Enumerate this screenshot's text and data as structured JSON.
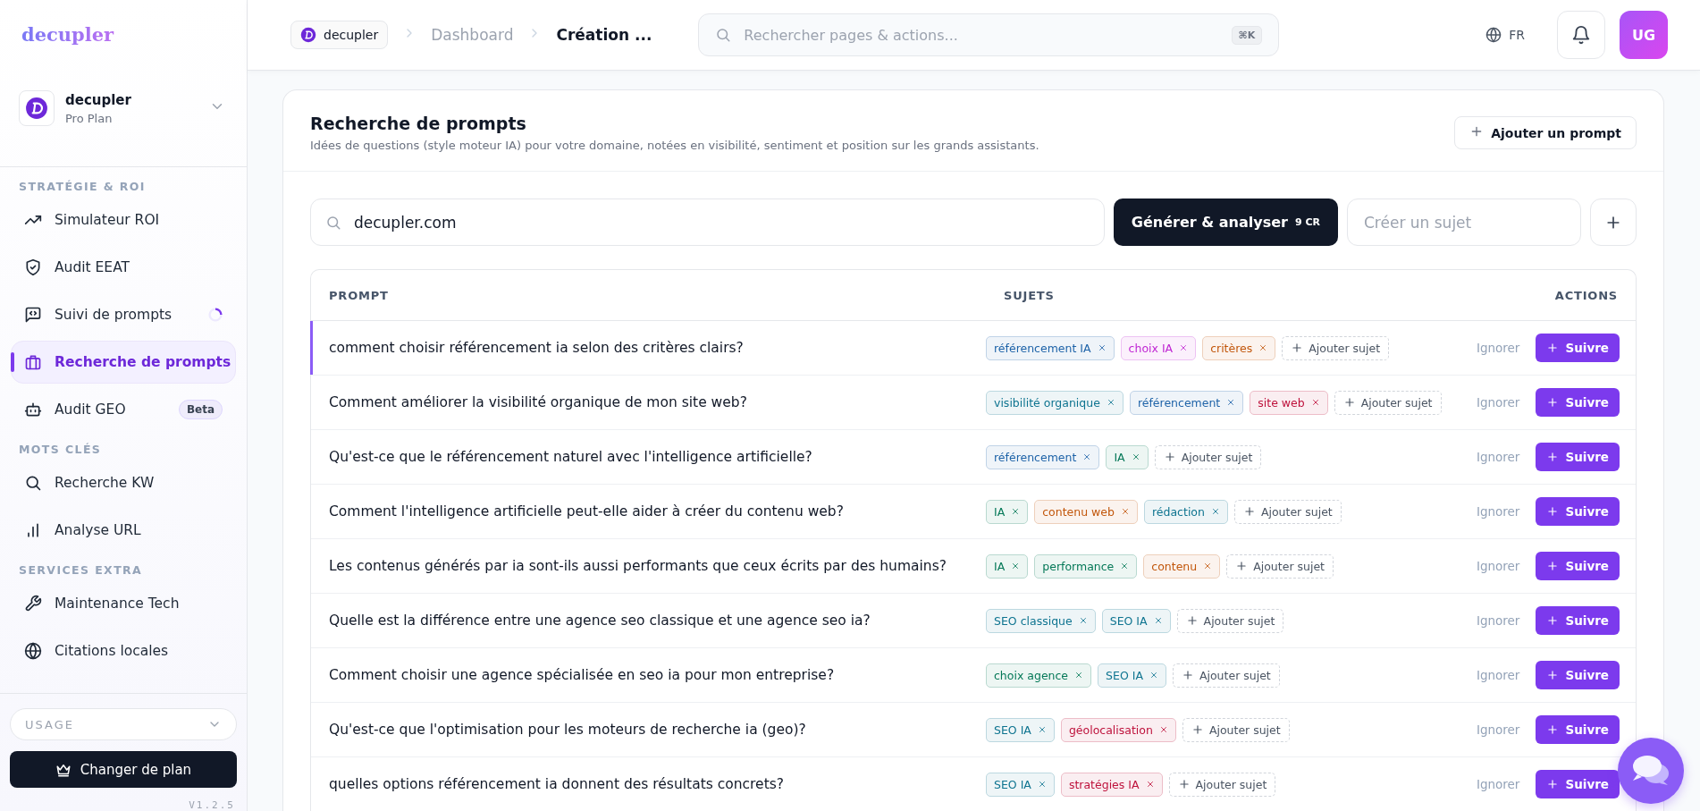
{
  "sidebar": {
    "logo": "decupler",
    "workspace": {
      "name": "decupler",
      "plan": "Pro Plan"
    },
    "sections": [
      {
        "title": "STRATÉGIE & ROI",
        "items": [
          {
            "label": "Simulateur ROI",
            "selected": false,
            "loading": false
          },
          {
            "label": "Audit EEAT",
            "selected": false,
            "loading": false
          },
          {
            "label": "Suivi de prompts",
            "selected": false,
            "loading": true
          },
          {
            "label": "Recherche de prompts",
            "selected": true,
            "loading": false
          },
          {
            "label": "Audit GEO",
            "selected": false,
            "loading": false,
            "badge": "Beta"
          }
        ]
      },
      {
        "title": "MOTS CLÉS",
        "items": [
          {
            "label": "Recherche KW",
            "selected": false,
            "loading": false
          },
          {
            "label": "Analyse URL",
            "selected": false,
            "loading": false
          }
        ]
      },
      {
        "title": "SERVICES EXTRA",
        "items": [
          {
            "label": "Maintenance Tech",
            "selected": false,
            "loading": false
          },
          {
            "label": "Citations locales",
            "selected": false,
            "loading": false
          }
        ]
      }
    ],
    "usage": "USAGE",
    "upgrade_button": "Changer de plan",
    "version": "V1.2.5"
  },
  "header": {
    "breadcrumb": {
      "workspace": "decupler",
      "items": [
        "Dashboard",
        "Création ..."
      ]
    },
    "search": {
      "placeholder": "Rechercher pages & actions...",
      "shortcut": "⌘K"
    },
    "language": "FR",
    "avatar": "UG"
  },
  "card": {
    "title": "Recherche de prompts",
    "subtitle": "Idées de questions (style moteur IA) pour votre domaine, notées en visibilité, sentiment et position sur les grands assistants.",
    "add_button": "Ajouter un prompt",
    "domain_field": {
      "value": "decupler.com"
    },
    "generate_button": {
      "label": "Générer & analyser",
      "cost": "9 CR"
    },
    "topic_field": {
      "placeholder": "Créer un sujet"
    },
    "table": {
      "columns": [
        "PROMPT",
        "SUJETS",
        "ACTIONS"
      ],
      "rows": [
        {
          "prompt": "comment choisir référencement ia selon des critères clairs?",
          "selected": true,
          "tags": [
            {
              "label": "référencement IA",
              "color": "#1e63a8"
            },
            {
              "label": "choix IA",
              "color": "#c026d3"
            },
            {
              "label": "critères",
              "color": "#c2570c"
            }
          ],
          "add_tag": "Ajouter sujet",
          "ignore": "Ignorer",
          "follow": "Suivre"
        },
        {
          "prompt": "Comment améliorer la visibilité organique de mon site web?",
          "selected": false,
          "tags": [
            {
              "label": "visibilité organique",
              "color": "#0e7490"
            },
            {
              "label": "référencement",
              "color": "#1e63a8"
            },
            {
              "label": "site web",
              "color": "#be123c"
            }
          ],
          "add_tag": "Ajouter sujet",
          "ignore": "Ignorer",
          "follow": "Suivre"
        },
        {
          "prompt": "Qu'est-ce que le référencement naturel avec l'intelligence artificielle?",
          "selected": false,
          "tags": [
            {
              "label": "référencement",
              "color": "#1e63a8"
            },
            {
              "label": "IA",
              "color": "#047857"
            }
          ],
          "add_tag": "Ajouter sujet",
          "ignore": "Ignorer",
          "follow": "Suivre"
        },
        {
          "prompt": "Comment l'intelligence artificielle peut-elle aider à créer du contenu web?",
          "selected": false,
          "tags": [
            {
              "label": "IA",
              "color": "#047857"
            },
            {
              "label": "contenu web",
              "color": "#c2570c"
            },
            {
              "label": "rédaction",
              "color": "#0e7490"
            }
          ],
          "add_tag": "Ajouter sujet",
          "ignore": "Ignorer",
          "follow": "Suivre"
        },
        {
          "prompt": "Les contenus générés par ia sont-ils aussi performants que ceux écrits par des humains?",
          "selected": false,
          "tags": [
            {
              "label": "IA",
              "color": "#047857"
            },
            {
              "label": "performance",
              "color": "#047857"
            },
            {
              "label": "contenu",
              "color": "#c2570c"
            }
          ],
          "add_tag": "Ajouter sujet",
          "ignore": "Ignorer",
          "follow": "Suivre"
        },
        {
          "prompt": "Quelle est la différence entre une agence seo classique et une agence seo ia?",
          "selected": false,
          "tags": [
            {
              "label": "SEO classique",
              "color": "#0e7490"
            },
            {
              "label": "SEO IA",
              "color": "#0e7490"
            }
          ],
          "add_tag": "Ajouter sujet",
          "ignore": "Ignorer",
          "follow": "Suivre"
        },
        {
          "prompt": "Comment choisir une agence spécialisée en seo ia pour mon entreprise?",
          "selected": false,
          "tags": [
            {
              "label": "choix agence",
              "color": "#047857"
            },
            {
              "label": "SEO IA",
              "color": "#0e7490"
            }
          ],
          "add_tag": "Ajouter sujet",
          "ignore": "Ignorer",
          "follow": "Suivre"
        },
        {
          "prompt": "Qu'est-ce que l'optimisation pour les moteurs de recherche ia (geo)?",
          "selected": false,
          "tags": [
            {
              "label": "SEO IA",
              "color": "#0e7490"
            },
            {
              "label": "géolocalisation",
              "color": "#be123c"
            }
          ],
          "add_tag": "Ajouter sujet",
          "ignore": "Ignorer",
          "follow": "Suivre"
        },
        {
          "prompt": "quelles options référencement ia donnent des résultats concrets?",
          "selected": false,
          "tags": [
            {
              "label": "SEO IA",
              "color": "#0e7490"
            },
            {
              "label": "stratégies IA",
              "color": "#be123c"
            }
          ],
          "add_tag": "Ajouter sujet",
          "ignore": "Ignorer",
          "follow": "Suivre"
        }
      ]
    }
  }
}
